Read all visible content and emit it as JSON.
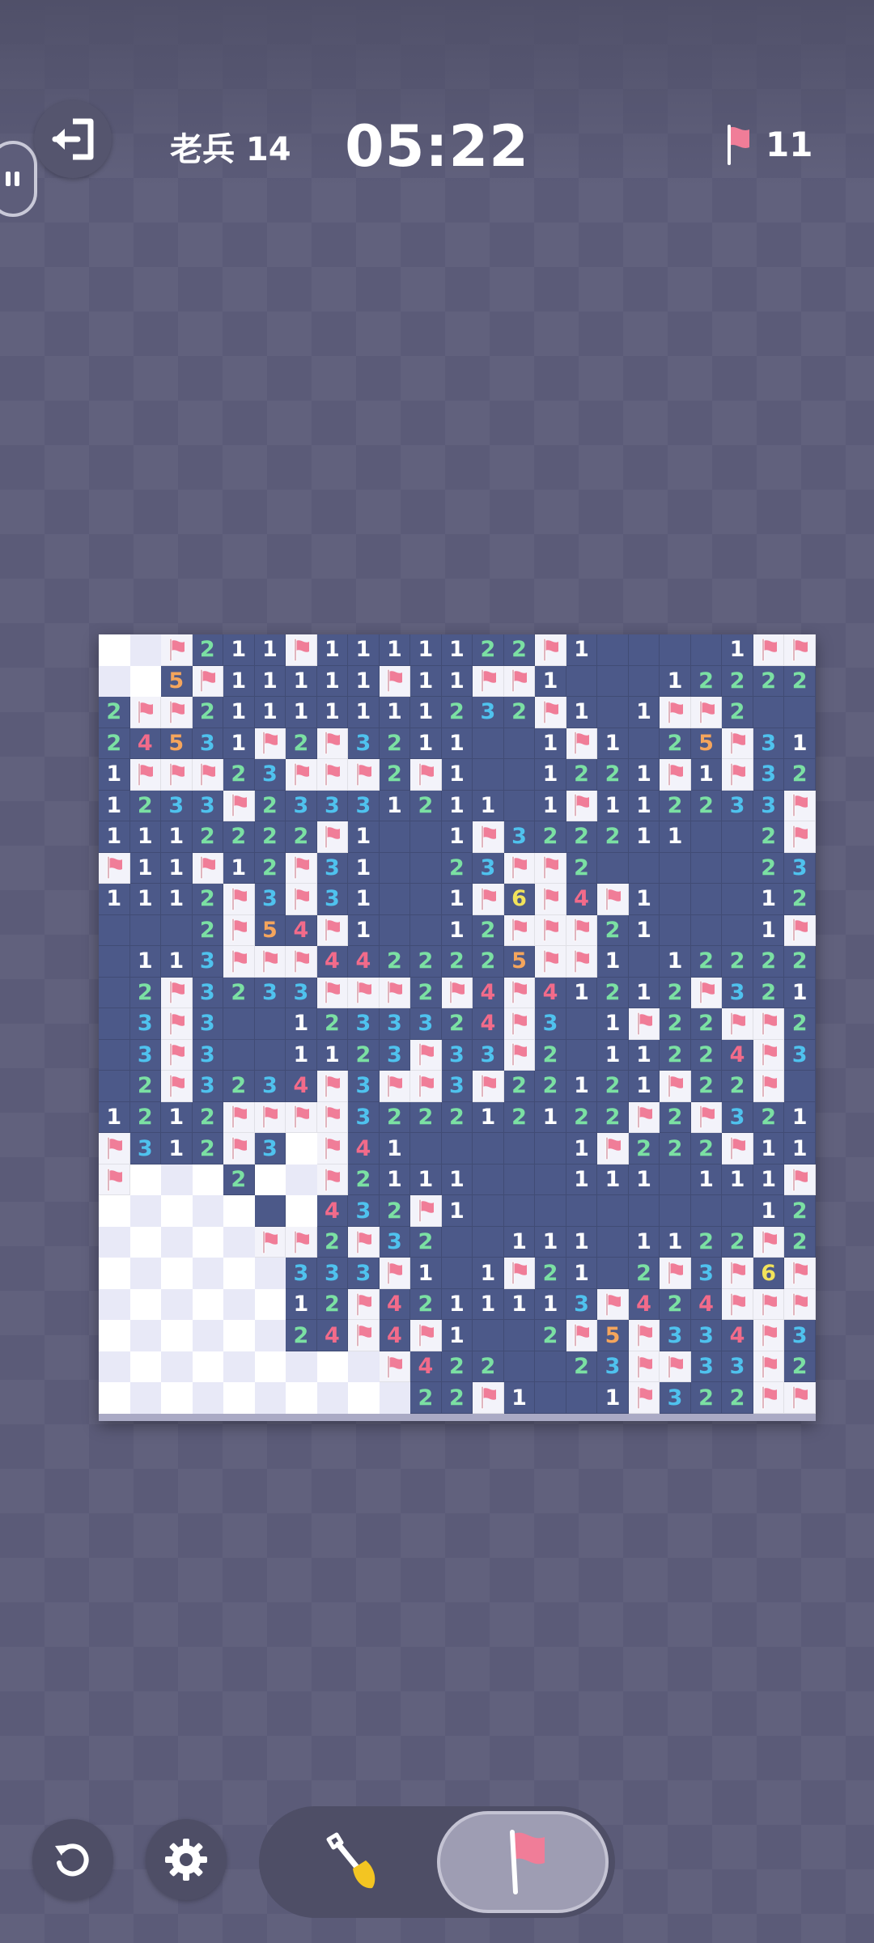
{
  "header": {
    "difficulty": "老兵 14",
    "timer": "05:22",
    "flags_remaining": "11"
  },
  "colors": {
    "1": "#ffffff",
    "2": "#7be0a3",
    "3": "#4fc2ee",
    "4": "#f26b8a",
    "5": "#f5a55c",
    "6": "#f2e35a",
    "flag": "#f07d98",
    "revealed": "#4c5989",
    "unrevealed_a": "#ffffff",
    "unrevealed_b": "#e8e9f7"
  },
  "board": {
    "cols": 23,
    "rows": 25,
    "legend": "digit = revealed number, '.' = revealed empty, F = flag, # = unrevealed",
    "cells": [
      "##F211F1111122F1....1FF",
      "##5F11111F11FF1...12222",
      "2FF21111111232F1.1FF2..",
      "24531F2F3211..1F1.25F311",
      "1FFF23FFF2F1..1221F1F32F",
      "1233F23331211.1F112233F3",
      "1112222F1..1F322211..2F2",
      "F11F12F31..23FF2.....233",
      "1112F3F31..1F6F4F1...12FF",
      "...2F54F1..12FFF21...1F4F",
      ".113FFF4422225FF1.122221",
      ".2F3233FFF2F4F41212F321",
      ".3F3..1233324F3.1F22FF2",
      ".3F3..1123F33F2.11224F3",
      ".2F3234F3FF3F22121F22F",
      "1212FFFF322212122F2F3212",
      "F312F3#F41.....1F222F113F",
      "F###2##F2111...111.111FF",
      "#####.#432F1.........1232",
      "#####FF2F32..111.1122F21",
      "######333F1.1F21.2F3F6F2",
      "######12F4211113F424FFF2",
      "######24F4F1..2F5F334F31",
      "#########F422..23FF33F2.",
      "##########22F1..1F322FF2."
    ]
  },
  "controls": {
    "undo": "undo-icon",
    "settings": "gear-icon",
    "dig_mode": "shovel-icon",
    "flag_mode": "flag-icon",
    "active_mode": "flag"
  }
}
